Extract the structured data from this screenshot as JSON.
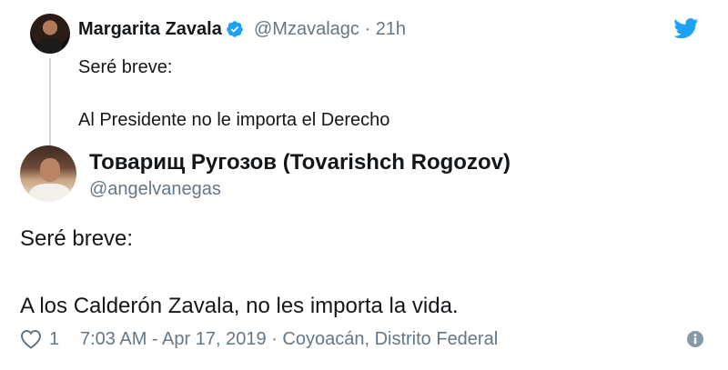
{
  "parent_tweet": {
    "author_name": "Margarita Zavala",
    "handle": "@Mzavalagc",
    "separator": "·",
    "time": "21h",
    "body": [
      "Seré breve:",
      "Al Presidente no le importa el Derecho"
    ]
  },
  "main_tweet": {
    "author_name": "Товарищ Ругозов (Tovarishch Rogozov)",
    "handle": "@angelvanegas",
    "body": [
      "Seré breve:",
      "A los Calderón Zavala, no les importa la vida."
    ],
    "likes": "1",
    "timestamp": "7:03 AM - Apr 17, 2019",
    "separator": "·",
    "location": "Coyoacán, Distrito Federal"
  },
  "icons": {
    "brand": "twitter-bird-icon",
    "verified": "verified-badge-icon",
    "like": "heart-icon",
    "info": "info-icon"
  },
  "colors": {
    "brand_blue": "#1da1f2",
    "muted_text": "#657786",
    "thread_line": "#ccd6dd"
  }
}
